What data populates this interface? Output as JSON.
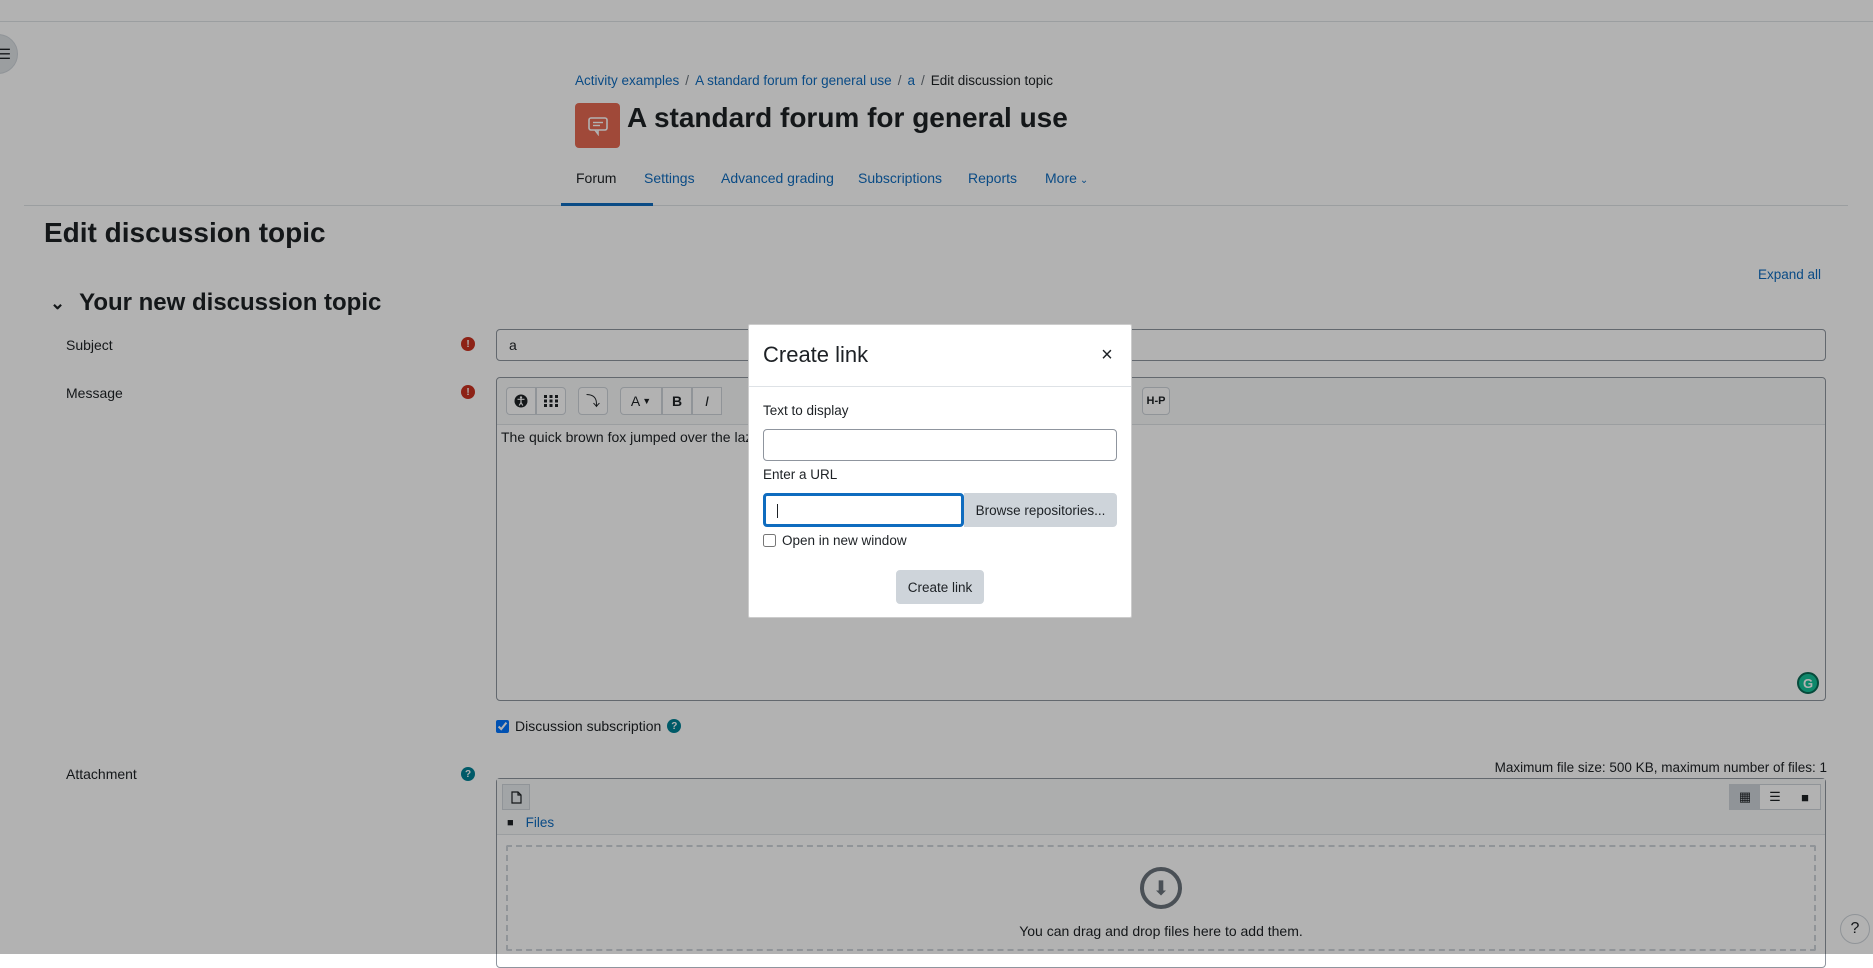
{
  "breadcrumb": {
    "items": [
      "Activity examples",
      "A standard forum for general use",
      "a"
    ],
    "current": "Edit discussion topic",
    "separator": "/"
  },
  "page": {
    "heading": "A standard forum for general use"
  },
  "secondary_nav": {
    "tabs": [
      {
        "label": "Forum",
        "active": true
      },
      {
        "label": "Settings"
      },
      {
        "label": "Advanced grading"
      },
      {
        "label": "Subscriptions"
      },
      {
        "label": "Reports"
      },
      {
        "label": "More"
      }
    ]
  },
  "form": {
    "title": "Edit discussion topic",
    "expand_all": "Expand all",
    "section_title": "Your new discussion topic",
    "subject_label": "Subject",
    "subject_value": "a",
    "message_label": "Message",
    "message_text": "The quick brown fox jumped over the lazy",
    "subscription_label": "Discussion subscription",
    "subscription_checked": true,
    "attachment_label": "Attachment",
    "max_file_size": "Maximum file size: 500 KB, maximum number of files: 1",
    "files_path": "Files",
    "drop_text": "You can drag and drop files here to add them."
  },
  "toolbar_icons": [
    "accessibility-icon",
    "apps-icon",
    "undo-redo-icon",
    "font-color-icon",
    "bold-icon",
    "italic-icon",
    "h5p-icon"
  ],
  "toolbar_labels": {
    "bold": "B",
    "italic": "I",
    "h5p": "H-P",
    "font": "A"
  },
  "modal": {
    "title": "Create link",
    "close_symbol": "×",
    "text_label": "Text to display",
    "text_value": "",
    "url_label": "Enter a URL",
    "url_value": "",
    "browse_label": "Browse repositories...",
    "newwindow_label": "Open in new window",
    "newwindow_checked": false,
    "create_label": "Create link"
  },
  "colors": {
    "primary": "#0f6cbf",
    "forum_icon_bg": "#e56952",
    "required": "#ca3120",
    "help": "#008196"
  }
}
